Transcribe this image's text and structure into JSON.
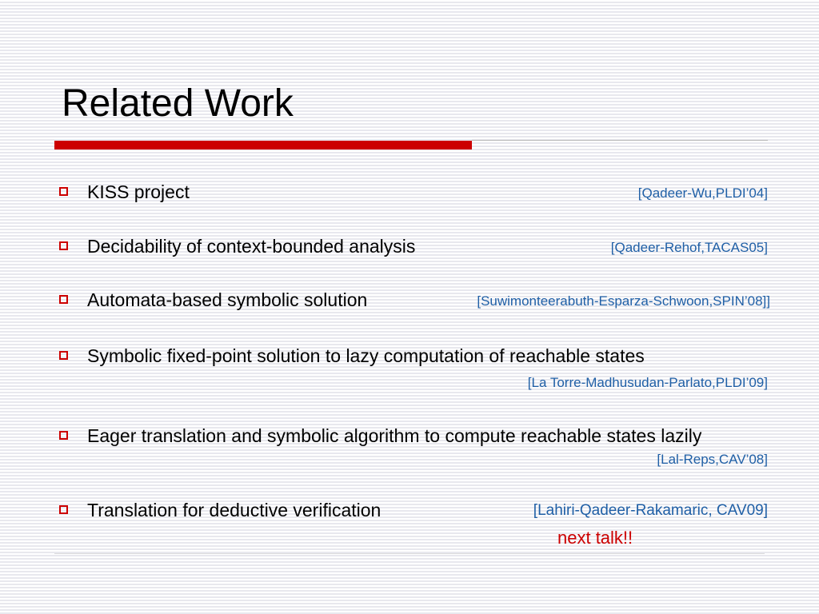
{
  "slide": {
    "title": "Related Work",
    "items": [
      {
        "text": "KISS project",
        "citation": "[Qadeer-Wu,PLDI’04]"
      },
      {
        "text": "Decidability of context-bounded analysis",
        "citation": "[Qadeer-Rehof,TACAS05]"
      },
      {
        "text": "Automata-based symbolic solution",
        "citation": "[Suwimonteerabuth-Esparza-Schwoon,SPIN’08]]"
      },
      {
        "text": "Symbolic fixed-point solution to lazy computation of reachable states",
        "citation": "[La Torre-Madhusudan-Parlato,PLDI’09]"
      },
      {
        "text": "Eager translation and symbolic algorithm to compute reachable states lazily",
        "citation": "[Lal-Reps,CAV’08]"
      },
      {
        "text": "Translation for deductive verification",
        "citation": "[Lahiri-Qadeer-Rakamaric, CAV09]"
      }
    ],
    "note": "next talk!!",
    "colors": {
      "accent": "#cc0000",
      "citation": "#1f5fa6",
      "text": "#000000"
    },
    "bullet_icon": "hollow-square-bullet-icon"
  }
}
